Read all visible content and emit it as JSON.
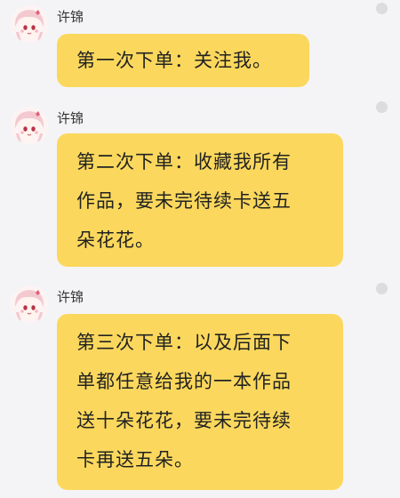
{
  "messages": [
    {
      "sender": "许锦",
      "lines": [
        "第一次下单：关注我。"
      ]
    },
    {
      "sender": "许锦",
      "lines": [
        "第二次下单：收藏我所有",
        "作品，要未完待续卡送五",
        "朵花花。"
      ]
    },
    {
      "sender": "许锦",
      "lines": [
        "第三次下单：以及后面下",
        "单都任意给我的一本作品",
        "送十朵花花，要未完待续",
        "卡再送五朵。"
      ]
    }
  ],
  "colors": {
    "bubble": "#fbd85d",
    "background": "#f4f4f6",
    "status_dot": "#dcdcde"
  },
  "icons": {
    "avatar": "anime-girl-avatar",
    "status": "status-dot"
  }
}
